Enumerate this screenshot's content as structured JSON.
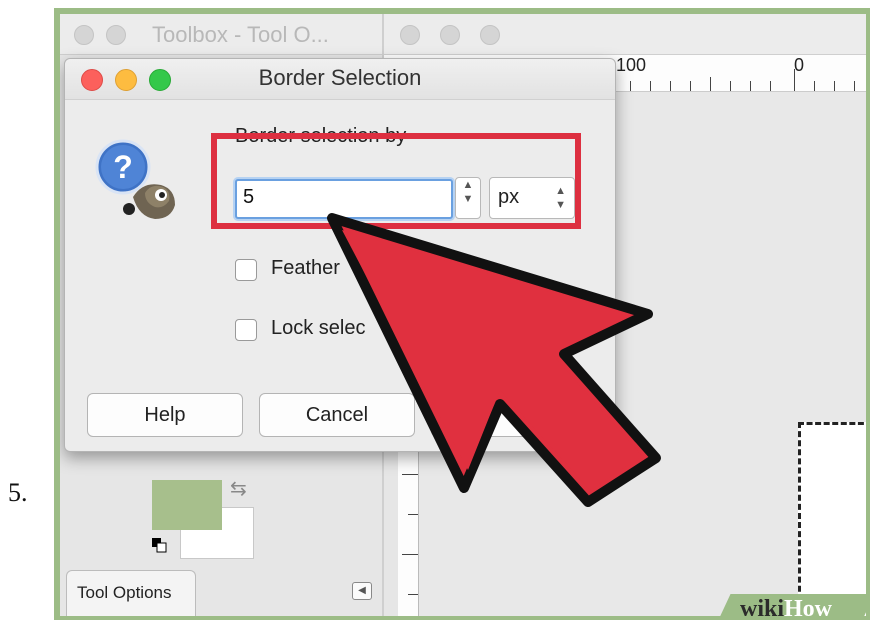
{
  "step": {
    "number": "5."
  },
  "toolbox": {
    "title": "Toolbox - Tool O...",
    "tab_label": "Tool Options"
  },
  "canvas": {
    "ruler_labels": [
      "-100",
      "0"
    ]
  },
  "dialog": {
    "title": "Border Selection",
    "section_label": "Border selection by",
    "border_value": "5",
    "unit": "px",
    "feather_label": "Feather",
    "lock_label": "Lock selec",
    "buttons": {
      "help": "Help",
      "cancel": "Cancel"
    }
  },
  "watermark": {
    "part1": "wiki",
    "part2": "How"
  },
  "colors": {
    "highlight": "#dd2f40",
    "arrow": "#e0303f",
    "frame": "#9cbc86",
    "foreground_swatch": "#a7bf8c",
    "mac_close": "#fc605c",
    "mac_minimize": "#fdbc40",
    "mac_zoom": "#34c84a"
  }
}
